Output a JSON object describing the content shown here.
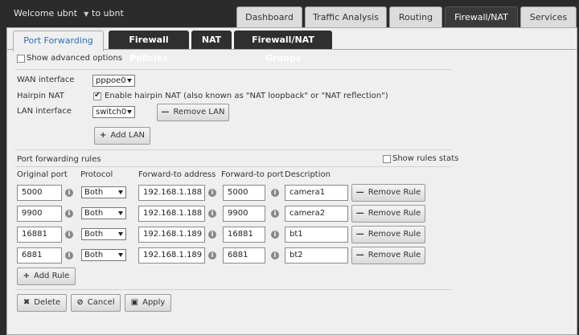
{
  "topbar": {
    "welcome": "Welcome ubnt",
    "to": "to ubnt",
    "tabs": [
      {
        "label": "Dashboard"
      },
      {
        "label": "Traffic Analysis"
      },
      {
        "label": "Routing"
      },
      {
        "label": "Firewall/NAT"
      },
      {
        "label": "Services"
      }
    ]
  },
  "subtabs": [
    {
      "label": "Port Forwarding"
    },
    {
      "label": "Firewall Policies"
    },
    {
      "label": "NAT"
    },
    {
      "label": "Firewall/NAT Groups"
    }
  ],
  "options": {
    "show_advanced": "Show advanced options",
    "wan_label": "WAN interface",
    "wan_value": "pppoe0",
    "hairpin_label": "Hairpin NAT",
    "hairpin_text": "Enable hairpin NAT (also known as \"NAT loopback\" or \"NAT reflection\")",
    "lan_label": "LAN interface",
    "lan_value": "switch0",
    "remove_lan": "Remove LAN",
    "add_lan": "Add LAN"
  },
  "rules": {
    "title": "Port forwarding rules",
    "show_stats": "Show rules stats",
    "headers": {
      "original_port": "Original port",
      "protocol": "Protocol",
      "forward_address": "Forward-to address",
      "forward_port": "Forward-to port",
      "description": "Description"
    },
    "rows": [
      {
        "original_port": "5000",
        "protocol": "Both",
        "forward_address": "192.168.1.188",
        "forward_port": "5000",
        "description": "camera1"
      },
      {
        "original_port": "9900",
        "protocol": "Both",
        "forward_address": "192.168.1.188",
        "forward_port": "9900",
        "description": "camera2"
      },
      {
        "original_port": "16881",
        "protocol": "Both",
        "forward_address": "192.168.1.189",
        "forward_port": "16881",
        "description": "bt1"
      },
      {
        "original_port": "6881",
        "protocol": "Both",
        "forward_address": "192.168.1.189",
        "forward_port": "6881",
        "description": "bt2"
      }
    ],
    "remove_rule": "Remove Rule",
    "add_rule": "Add Rule"
  },
  "actions": {
    "delete": "Delete",
    "cancel": "Cancel",
    "apply": "Apply"
  },
  "colors": {
    "active_subtab": "#2f6fb5",
    "topbar_bg": "#2b2b2b"
  }
}
